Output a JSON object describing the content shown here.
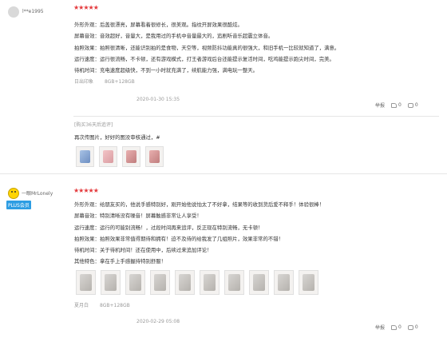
{
  "reviews": [
    {
      "user": "l**e1995",
      "stars": "★★★★★",
      "lines": [
        "外形外观：后盖很漂亮，屏幕看着很修长，很美观。指纹开屏效果很酷炫。",
        "屏幕音效：音效超好，音量大，是我用过的手机中音量最大的，追剧听音乐超震立体音。",
        "拍照效果：拍照很清晰，还能识别拍的是食物，天空等，视频防抖功能真的很强大，和旧手机一比较就知道了，满意。",
        "运行速度：运行很流畅，不卡顿，还有游戏模式，打王者游戏后台还能提示复活时间，吃鸡能提示跑尖时间，完美。",
        "待机时间：充电速度超级快，不到一小时就充满了，续航能力强，满电玩一整天。"
      ],
      "specs": [
        "日出印象",
        "8GB+128GB"
      ],
      "date": "2020-01-30 15:35",
      "report": "举报",
      "likes": "0",
      "comments": "0",
      "added_tag": "[购买36天后追评]",
      "added_text": "再次传图片，好好的图没审核通过，#",
      "thumbs": [
        "blue",
        "pink",
        "red",
        "red"
      ]
    },
    {
      "user": "一眼MrLonely",
      "badge": "PLUS会员",
      "stars": "★★★★★",
      "lines": [
        "外形外观：给朋友买的，他说手感特别好，刚开始他说怕太了不好拿，结果等的收到货后爱不释手！体验很棒！",
        "屏幕音效：特别清晰没有噪音！屏幕触感非常让人享受！",
        "运行速度：运行的可能别流畅！，过段时间再来追评，反正现在特别流畅，无卡顿！",
        "拍照效果：拍照效果非常值得期待和拥有！迫不及待的给我发了几组照片，效果非常的不错！",
        "待机时间：关于待机时间！还在使用中，后续过来追加评论！",
        "其他特色：拿在手上手感握持特别舒服！"
      ],
      "specs": [
        "夏月白",
        "8GB+128GB"
      ],
      "date": "2020-02-29 05:08",
      "report": "举报",
      "likes": "0",
      "comments": "0",
      "thumbs": [
        "plain",
        "plain",
        "plain",
        "plain",
        "plain",
        "plain",
        "plain",
        "plain",
        "plain",
        "plain"
      ]
    }
  ]
}
